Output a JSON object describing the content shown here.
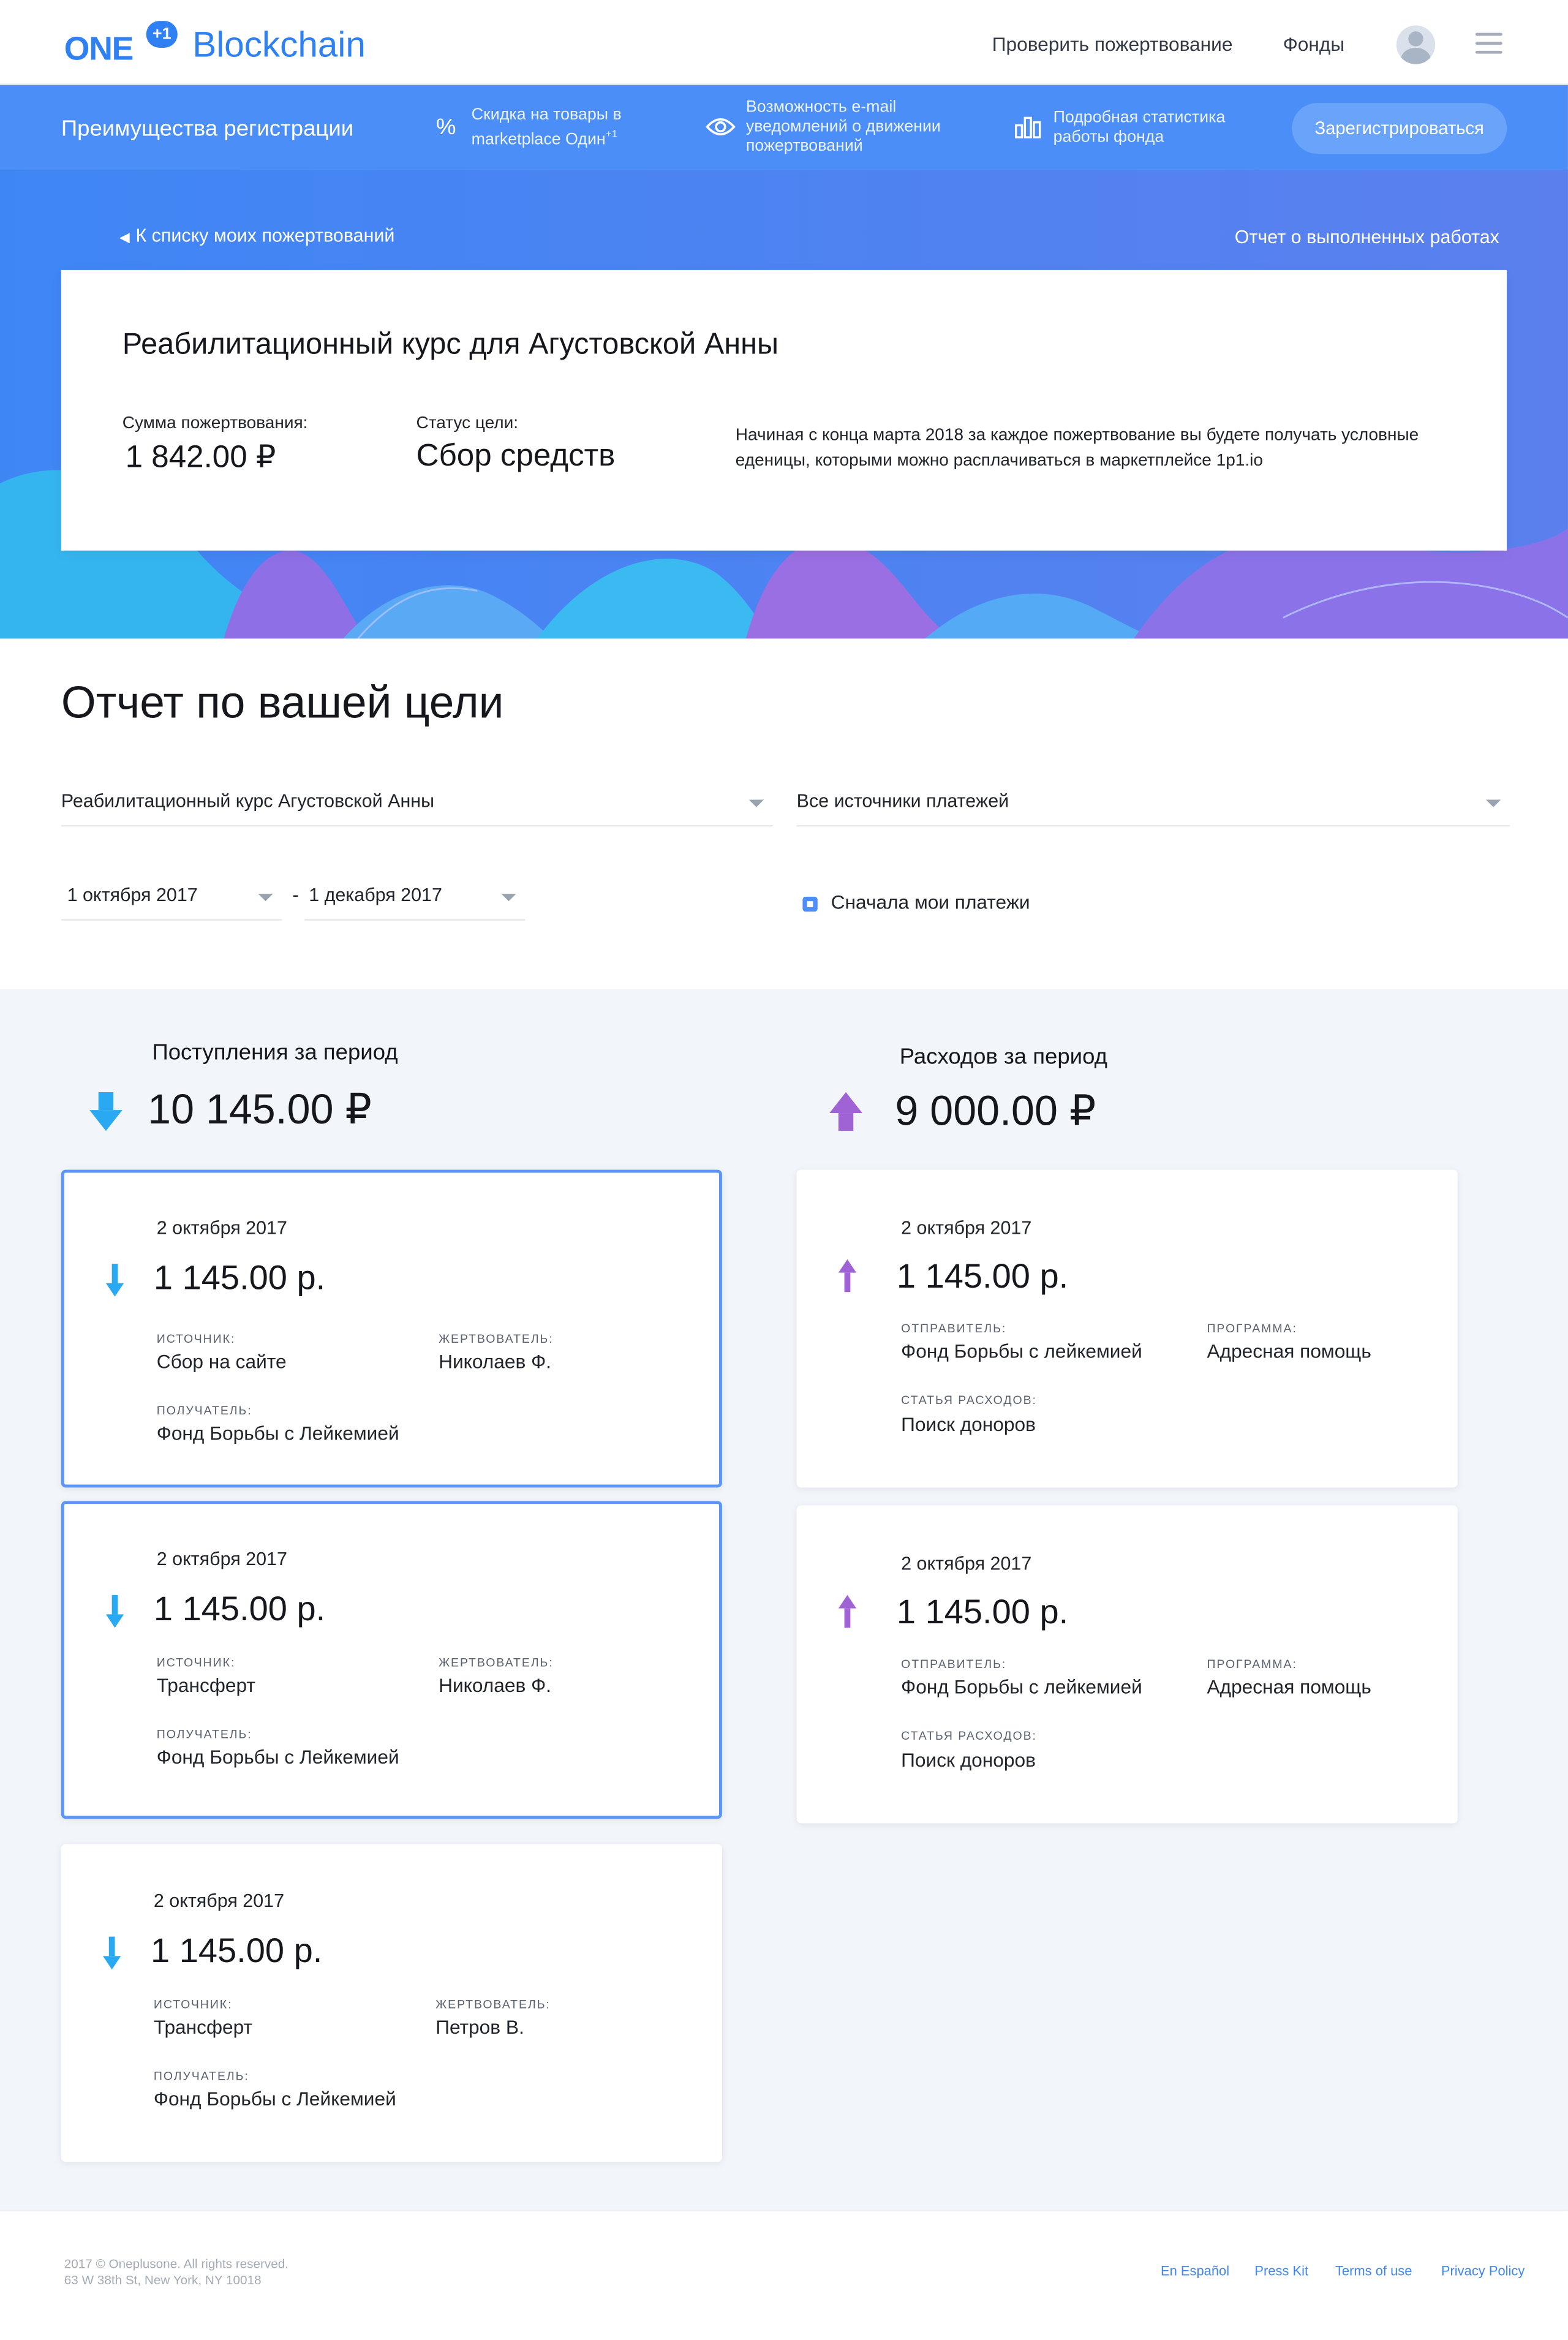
{
  "header": {
    "logo_one": "ONE",
    "logo_badge": "+1",
    "logo_word": "Blockchain",
    "nav": [
      "Проверить пожертвование",
      "Фонды"
    ]
  },
  "benefits": {
    "title": "Преимущества регистрации",
    "items": [
      {
        "icon": "percent-icon",
        "line1": "Скидка на товары в",
        "line2": "marketplace Один",
        "sup": "+1"
      },
      {
        "icon": "eye-icon",
        "line1": "Возможность e-mail",
        "line2": "уведомлений о движении",
        "line3": "пожертвований"
      },
      {
        "icon": "bar-chart-icon",
        "line1": "Подробная статистика",
        "line2": "работы фонда"
      }
    ],
    "register": "Зарегистрироваться"
  },
  "hero": {
    "back": "К списку моих пожертвований",
    "report_link": "Отчет о выполненных работах",
    "card": {
      "title": "Реабилитационный курс для Агустовской Анны",
      "amount_label": "Сумма пожертвования:",
      "amount": "1 842.00 ₽",
      "status_label": "Статус цели:",
      "status": "Сбор средств",
      "note": "Начиная с конца марта 2018 за каждое пожертвование вы будете получать условные еденицы, которыми можно расплачиваться в маркетплейсе 1p1.io"
    }
  },
  "report": {
    "title": "Отчет по вашей цели",
    "goal_select": "Реабилитационный курс Агустовской Анны",
    "source_select": "Все источники платежей",
    "date_from": "1 октября 2017",
    "date_sep": "-",
    "date_to": "1 декабря 2017",
    "my_first": "Сначала мои платежи"
  },
  "income": {
    "label": "Поступления за период",
    "total": "10 145.00 ₽",
    "cards": [
      {
        "date": "2 октября 2017",
        "amount": "1 145.00 р.",
        "source_label": "ИСТОЧНИК:",
        "source": "Сбор на сайте",
        "donor_label": "ЖЕРТВОВАТЕЛЬ:",
        "donor": "Николаев Ф.",
        "recipient_label": "ПОЛУЧАТЕЛЬ:",
        "recipient": "Фонд Борьбы с Лейкемией"
      },
      {
        "date": "2 октября 2017",
        "amount": "1 145.00 р.",
        "source_label": "ИСТОЧНИК:",
        "source": "Трансферт",
        "donor_label": "ЖЕРТВОВАТЕЛЬ:",
        "donor": "Николаев Ф.",
        "recipient_label": "ПОЛУЧАТЕЛЬ:",
        "recipient": "Фонд Борьбы с Лейкемией"
      },
      {
        "date": "2 октября 2017",
        "amount": "1 145.00 р.",
        "source_label": "ИСТОЧНИК:",
        "source": "Трансферт",
        "donor_label": "ЖЕРТВОВАТЕЛЬ:",
        "donor": "Петров В.",
        "recipient_label": "ПОЛУЧАТЕЛЬ:",
        "recipient": "Фонд Борьбы с Лейкемией"
      }
    ]
  },
  "expense": {
    "label": "Расходов за период",
    "total": "9 000.00 ₽",
    "cards": [
      {
        "date": "2 октября 2017",
        "amount": "1 145.00 р.",
        "sender_label": "ОТПРАВИТЕЛЬ:",
        "sender": "Фонд Борьбы с лейкемией",
        "program_label": "ПРОГРАММА:",
        "program": "Адресная помощь",
        "item_label": "СТАТЬЯ РАСХОДОВ:",
        "item": "Поиск доноров"
      },
      {
        "date": "2 октября 2017",
        "amount": "1 145.00 р.",
        "sender_label": "ОТПРАВИТЕЛЬ:",
        "sender": "Фонд Борьбы с лейкемией",
        "program_label": "ПРОГРАММА:",
        "program": "Адресная помощь",
        "item_label": "СТАТЬЯ РАСХОДОВ:",
        "item": "Поиск доноров"
      }
    ]
  },
  "footer": {
    "copyright": "2017 © Oneplusone. All rights reserved.",
    "address": "63 W 38th St, New York, NY 10018",
    "links": [
      "En Español",
      "Press Kit",
      "Terms of use",
      "Privacy Policy"
    ]
  },
  "colors": {
    "brand": "#2f80f3",
    "bar": "#4b8ef7",
    "income_arrow": "#29a9f2",
    "expense_arrow": "#a063d6"
  }
}
